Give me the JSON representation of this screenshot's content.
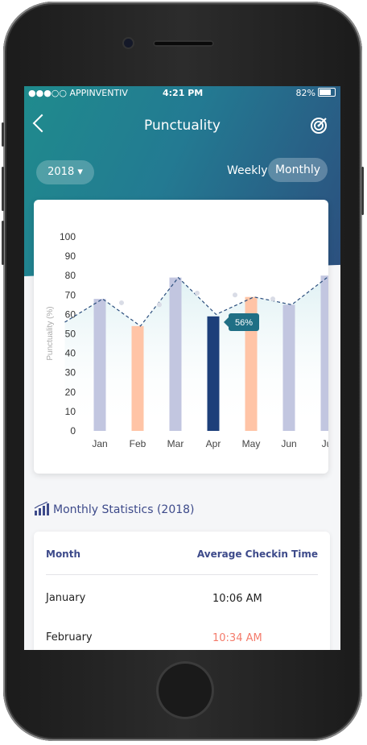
{
  "status_bar": {
    "carrier": "●●●○○ APPINVENTIV",
    "time": "4:21 PM",
    "battery": "82%"
  },
  "header": {
    "title": "Punctuality"
  },
  "filters": {
    "year": "2018 ▾",
    "weekly": "Weekly",
    "monthly": "Monthly"
  },
  "chart_data": {
    "type": "bar",
    "ylabel": "Punctuality (%)",
    "ylim": [
      0,
      100
    ],
    "yticks": [
      "100",
      "90",
      "80",
      "70",
      "60",
      "50",
      "40",
      "30",
      "20",
      "10",
      "0"
    ],
    "categories": [
      "Jan",
      "Feb",
      "Mar",
      "Apr",
      "May",
      "Jun",
      "Ju"
    ],
    "values": [
      68,
      54,
      79,
      59,
      69,
      65,
      80
    ],
    "bar_colors": [
      "#c2c6e0",
      "#ffc4a6",
      "#c2c6e0",
      "#1d3f7a",
      "#ffc4a6",
      "#c2c6e0",
      "#c2c6e0"
    ],
    "trend_line": [
      56,
      68,
      54,
      79,
      60,
      69,
      65,
      80
    ],
    "trend_markers": [
      66,
      65,
      71,
      70,
      68
    ],
    "selected_label": "56%"
  },
  "stats": {
    "title": "Monthly Statistics (2018)"
  },
  "table": {
    "col_month": "Month",
    "col_time": "Average Checkin Time",
    "rows": [
      {
        "month": "January",
        "time": "10:06 AM"
      },
      {
        "month": "February",
        "time": "10:34 AM"
      }
    ],
    "late_color": "#f47b6b"
  }
}
